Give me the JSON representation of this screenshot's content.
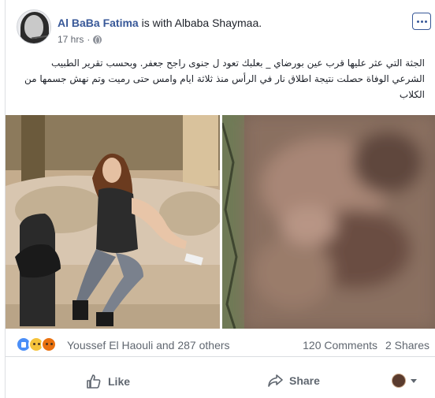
{
  "post": {
    "author": "Al BaBa Fatima",
    "with_text": " is with ",
    "tagged": "Albaba Shaymaa",
    "tagged_suffix": ".",
    "time": "17 hrs",
    "time_separator": "·",
    "privacy_icon": "globe-icon",
    "menu_icon": "more-options-icon",
    "text_lines": [
      "الجثة التي عثر عليها قرب عين بورضاي _ بعلبك تعود ل جنوى راجح جعفر. وبحسب تقرير الطبيب",
      "الشرعي الوفاة حصلت نتيجة اطلاق نار في الرأس منذ ثلاثة ايام وامس حتى رميت وتم نهش جسمها من",
      "الكلاب"
    ]
  },
  "reactions": {
    "icons": [
      "like-reaction-icon",
      "sad-reaction-icon",
      "angry-reaction-icon"
    ],
    "summary": "Youssef El Haouli and 287 others",
    "comments": "120 Comments",
    "shares": "2 Shares"
  },
  "actions": {
    "like": "Like",
    "share": "Share"
  },
  "colors": {
    "link": "#385898",
    "muted": "#606770",
    "like_blue": "#4a8ef7",
    "sad_yellow": "#f5c33b",
    "angry_orange": "#e9710f"
  }
}
